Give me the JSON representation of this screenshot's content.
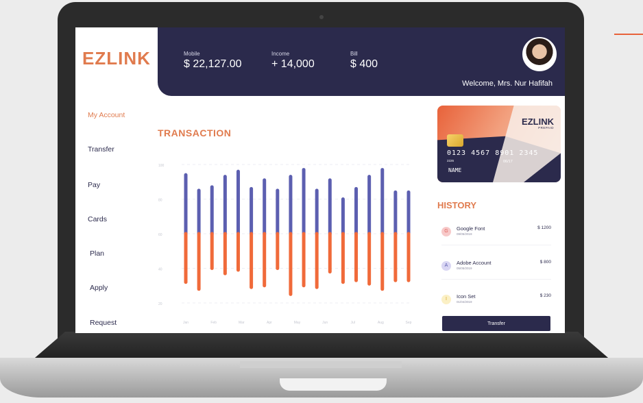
{
  "brand": {
    "logo": "EZLINK",
    "accent": "#e07b4e",
    "navy": "#2b2a4c"
  },
  "header": {
    "stats": [
      {
        "label": "Mobile",
        "value": "$ 22,127.00"
      },
      {
        "label": "Income",
        "value": "+ 14,000"
      },
      {
        "label": "Bill",
        "value": "$ 400"
      }
    ],
    "welcome": "Welcome,  Mrs. Nur Hafifah"
  },
  "nav": {
    "items": [
      {
        "label": "My Account",
        "active": true
      },
      {
        "label": "Transfer"
      },
      {
        "label": "Pay"
      },
      {
        "label": "Cards"
      },
      {
        "label": "Plan"
      },
      {
        "label": "Apply"
      },
      {
        "label": "Request"
      }
    ]
  },
  "transaction": {
    "title": "TRANSACTION"
  },
  "chart_data": {
    "type": "bar",
    "y_ticks": [
      100,
      80,
      60,
      40,
      20
    ],
    "ylim": [
      20,
      100
    ],
    "categories": [
      "Jan",
      "Feb",
      "Mar",
      "Apr",
      "May",
      "Jun",
      "Jul",
      "Aug",
      "Sep"
    ],
    "bars_per_category": 2,
    "series": [
      {
        "values": [
          94,
          85,
          87,
          93,
          96,
          86,
          91,
          85,
          93,
          97,
          85,
          91,
          80,
          86,
          93,
          97,
          84,
          84
        ],
        "color": "#5c5fb0"
      },
      {
        "values": [
          32,
          28,
          40,
          37,
          39,
          29,
          30,
          40,
          25,
          30,
          29,
          38,
          32,
          33,
          31,
          28,
          33,
          33
        ],
        "color": "#f06a3a"
      }
    ],
    "split_value": 60,
    "grid": true
  },
  "card": {
    "logo": "EZLINK",
    "sub": "PREPAID",
    "number": "0123 4567 8901 2345",
    "small": "2226",
    "expiry": "06/17",
    "name": "NAME"
  },
  "history": {
    "title": "HISTORY",
    "items": [
      {
        "initial": "G",
        "name": "Google Font",
        "date": "09/05/2019",
        "amount": "$ 1200",
        "color": "#f7c9c9",
        "textColor": "#e0605a"
      },
      {
        "initial": "A",
        "name": "Adobe Account",
        "date": "05/05/2019",
        "amount": "$ 800",
        "color": "#d9d6f3",
        "textColor": "#5c5fb0"
      },
      {
        "initial": "I",
        "name": "Icon Set",
        "date": "01/04/2019",
        "amount": "$ 230",
        "color": "#fbf0c5",
        "textColor": "#d8a92a"
      }
    ],
    "transfer_label": "Transfer"
  }
}
